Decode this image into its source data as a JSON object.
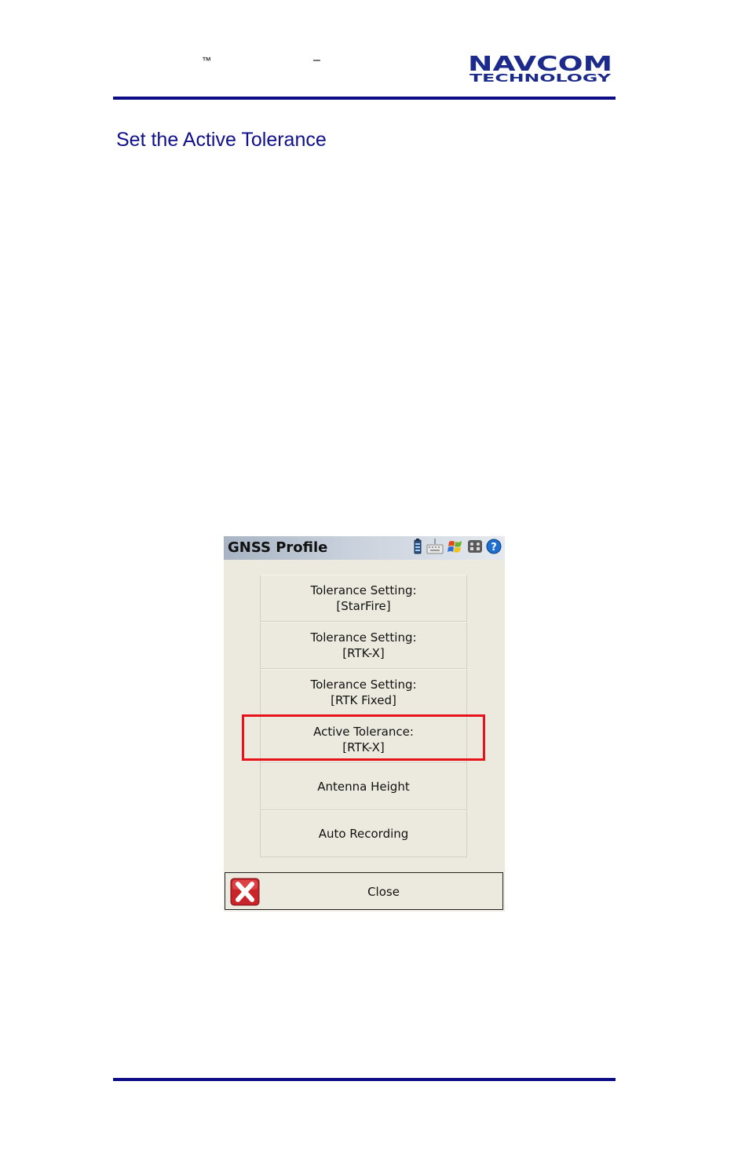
{
  "header": {
    "trademark": "™",
    "dash": "–",
    "logo": {
      "line1": "NAVCOM",
      "line2": "TECHNOLOGY",
      "color": "#1c2a8c"
    }
  },
  "heading": "Set the Active Tolerance",
  "colors": {
    "rule": "#0c0c84",
    "heading": "#10108c",
    "highlight": "#e8121c"
  },
  "device": {
    "title": "GNSS Profile",
    "tray_icons": [
      "battery-icon",
      "keyboard-icon",
      "windows-flag-icon",
      "grid-icon",
      "help-icon"
    ],
    "menu": [
      {
        "line1": "Tolerance Setting:",
        "line2": "[StarFire]"
      },
      {
        "line1": "Tolerance Setting:",
        "line2": "[RTK-X]"
      },
      {
        "line1": "Tolerance Setting:",
        "line2": "[RTK Fixed]"
      },
      {
        "line1": "Active Tolerance:",
        "line2": "[RTK-X]"
      },
      {
        "line1": "Antenna Height",
        "line2": ""
      },
      {
        "line1": "Auto Recording",
        "line2": ""
      }
    ],
    "close_label": "Close"
  }
}
